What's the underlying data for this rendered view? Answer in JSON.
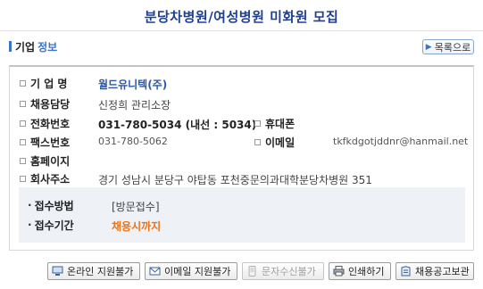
{
  "page_title": "분당차병원/여성병원 미화원 모집",
  "section": {
    "label_part1": "기업",
    "label_part2": "정보"
  },
  "list_button": "목록으로",
  "company_info": {
    "company_name_label": "기 업 명",
    "company_name": "월드유니텍(주)",
    "recruiter_label": "채용담당",
    "recruiter": "신정희 관리소장",
    "phone_label": "전화번호",
    "phone": "031-780-5034 (내선 : 5034)",
    "mobile_label": "휴대폰",
    "mobile": "",
    "fax_label": "팩스번호",
    "fax": "031-780-5062",
    "email_label": "이메일",
    "email": "tkfkdgotjddnr@hanmail.net",
    "homepage_label": "홈페이지",
    "homepage": "",
    "address_label": "회사주소",
    "address": "경기 성남시 분당구 야탑동 포천중문의과대학분당차병원 351"
  },
  "reception": {
    "method_label": "접수방법",
    "method": "[방문접수]",
    "period_label": "접수기간",
    "period": "채용시까지"
  },
  "actions": [
    {
      "label": "온라인 지원불가",
      "icon": "computer-icon",
      "enabled": true
    },
    {
      "label": "이메일 지원불가",
      "icon": "email-icon",
      "enabled": true
    },
    {
      "label": "문자수신불가",
      "icon": "phone-icon",
      "enabled": false
    },
    {
      "label": "인쇄하기",
      "icon": "print-icon",
      "enabled": true
    },
    {
      "label": "채용공고보관",
      "icon": "save-icon",
      "enabled": true
    }
  ],
  "colors": {
    "title": "#1f3f8f",
    "accent": "#3b74c6",
    "highlight": "#e8741c",
    "panel_bg": "#eef2f6"
  }
}
